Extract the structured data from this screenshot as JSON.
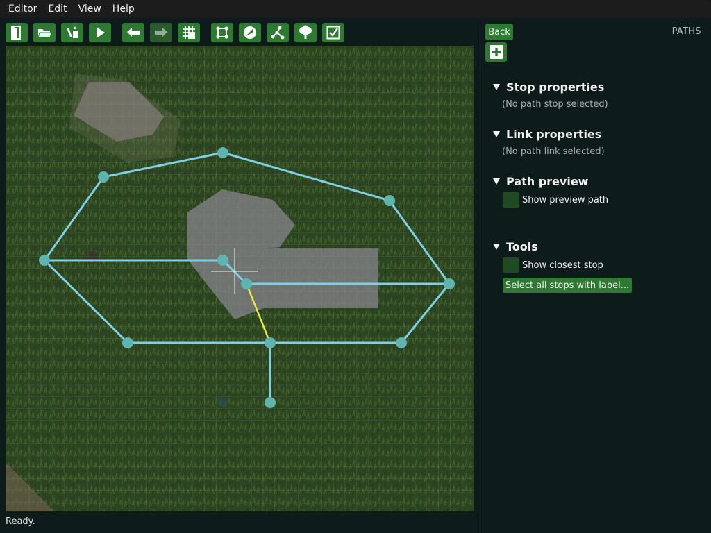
{
  "menu": {
    "items": [
      "Editor",
      "Edit",
      "View",
      "Help"
    ]
  },
  "toolbar": {
    "buttons": [
      {
        "name": "quit-editor",
        "icon": "exit-door-icon"
      },
      {
        "name": "open",
        "icon": "folder-icon"
      },
      {
        "name": "save",
        "icon": "save-icon"
      },
      {
        "name": "play",
        "icon": "play-icon"
      },
      {
        "name": "undo",
        "icon": "undo-icon"
      },
      {
        "name": "redo",
        "icon": "redo-icon",
        "disabled": true
      },
      {
        "name": "grid-snap",
        "icon": "grid-snap-icon"
      },
      {
        "name": "layout-mode",
        "icon": "layout-icon"
      },
      {
        "name": "mobs-mode",
        "icon": "mob-icon"
      },
      {
        "name": "paths-mode",
        "icon": "paths-icon"
      },
      {
        "name": "details-mode",
        "icon": "tree-icon"
      },
      {
        "name": "review-mode",
        "icon": "checkbox-icon"
      }
    ]
  },
  "status": {
    "text": "Ready."
  },
  "panel": {
    "back_label": "Back",
    "title": "PATHS",
    "add_icon": "add-icon",
    "sections": {
      "stop": {
        "header": "Stop properties",
        "note": "(No path stop selected)"
      },
      "link": {
        "header": "Link properties",
        "note": "(No path link selected)"
      },
      "preview": {
        "header": "Path preview",
        "checkbox_label": "Show preview path"
      },
      "tools": {
        "header": "Tools",
        "checkbox_label": "Show closest stop",
        "button_label": "Select all stops with label..."
      }
    }
  },
  "colors": {
    "accent": "#2e7a32",
    "path_link": "#7fd0e6",
    "path_stop": "#5fb3b0",
    "selected_link": "#e8e84a",
    "grass": "#2f4a1f"
  }
}
